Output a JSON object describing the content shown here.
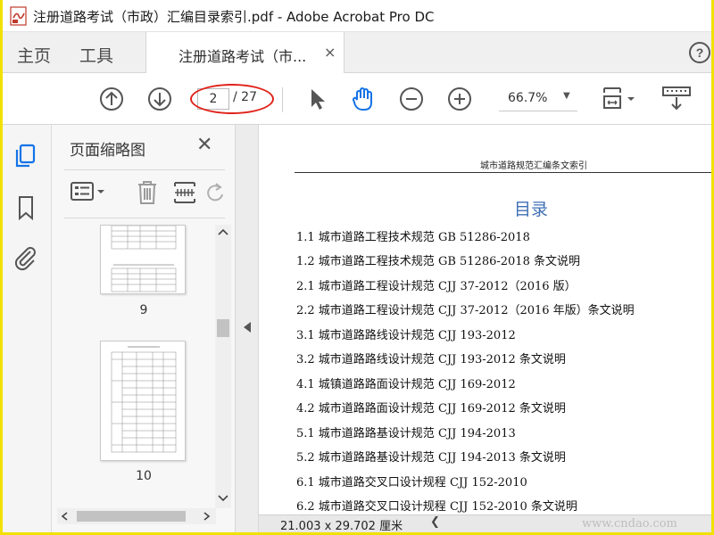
{
  "window": {
    "title": "注册道路考试（市政）汇编目录索引.pdf - Adobe Acrobat Pro DC"
  },
  "tabs": {
    "home": "主页",
    "tools": "工具",
    "document": "注册道路考试（市...",
    "close_symbol": "×",
    "help_symbol": "?"
  },
  "toolbar": {
    "current_page": "2",
    "total_pages": "/ 27",
    "zoom": "66.7%",
    "icons": [
      "arrow-up-circle",
      "arrow-down-circle",
      "pointer",
      "hand",
      "zoom-out",
      "zoom-in",
      "page-fit",
      "keyboard-scroll"
    ]
  },
  "panel": {
    "title": "页面缩略图",
    "close_symbol": "✕",
    "thumbnails": [
      {
        "label": "9"
      },
      {
        "label": "10"
      }
    ]
  },
  "document": {
    "header": "城市道路规范汇编条文索引",
    "heading": "目录",
    "toc": [
      "1.1 城市道路工程技术规范  GB 51286-2018",
      "1.2 城市道路工程技术规范 GB 51286-2018 条文说明",
      "2.1 城市道路工程设计规范  CJJ 37-2012（2016 版）",
      "2.2 城市道路工程设计规范 CJJ 37-2012（2016 年版）条文说明",
      "3.1 城市道路路线设计规范 CJJ 193-2012",
      "3.2 城市道路路线设计规范 CJJ 193-2012 条文说明",
      "4.1 城镇道路路面设计规范 CJJ 169-2012",
      "4.2 城市道路路面设计规范 CJJ 169-2012 条文说明",
      "5.1 城市道路路基设计规范 CJJ 194-2013",
      "5.2 城市道路路基设计规范 CJJ 194-2013 条文说明",
      "6.1 城市道路交叉口设计规程 CJJ 152-2010",
      "6.2 城市道路交叉口设计规程 CJJ 152-2010 条文说明"
    ]
  },
  "status": {
    "page_size": "21.003 x 29.702 厘米",
    "watermark": "www.cndao.com"
  },
  "colors": {
    "frame": "#f2e100",
    "heading": "#3f6fb4",
    "accent_icon": "#1473e6",
    "highlight": "#e0231a"
  }
}
